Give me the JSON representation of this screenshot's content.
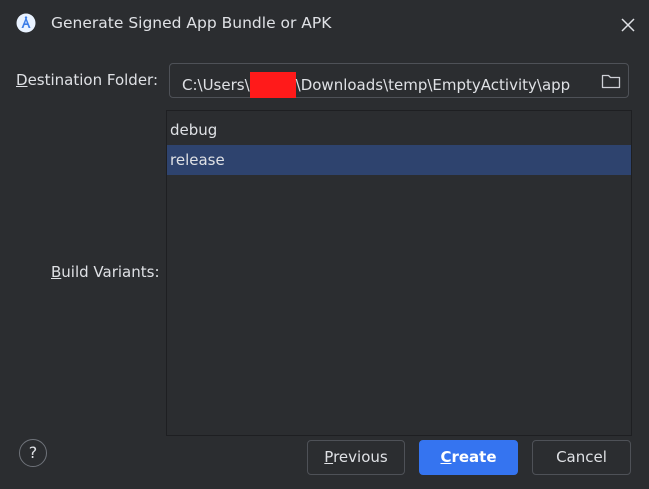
{
  "window": {
    "title": "Generate Signed App Bundle or APK",
    "icon": "android-studio-icon",
    "close_icon": "close-icon"
  },
  "destination": {
    "label_mnemonic": "D",
    "label_rest": "estination Folder:",
    "path_prefix": "C:\\Users\\",
    "path_suffix": "\\Downloads\\temp\\EmptyActivity\\app",
    "redacted_color": "#ff1a1a",
    "browse_icon": "folder-icon"
  },
  "build_variants": {
    "label_mnemonic": "B",
    "label_rest": "uild Variants:",
    "items": [
      {
        "label": "debug",
        "selected": false
      },
      {
        "label": "release",
        "selected": true
      }
    ],
    "selection_color": "#2e436e"
  },
  "footer": {
    "help_label": "?",
    "previous_mnemonic": "P",
    "previous_rest": "revious",
    "create_mnemonic": "C",
    "create_rest": "reate",
    "cancel_label": "Cancel",
    "accent_color": "#3574f0"
  }
}
